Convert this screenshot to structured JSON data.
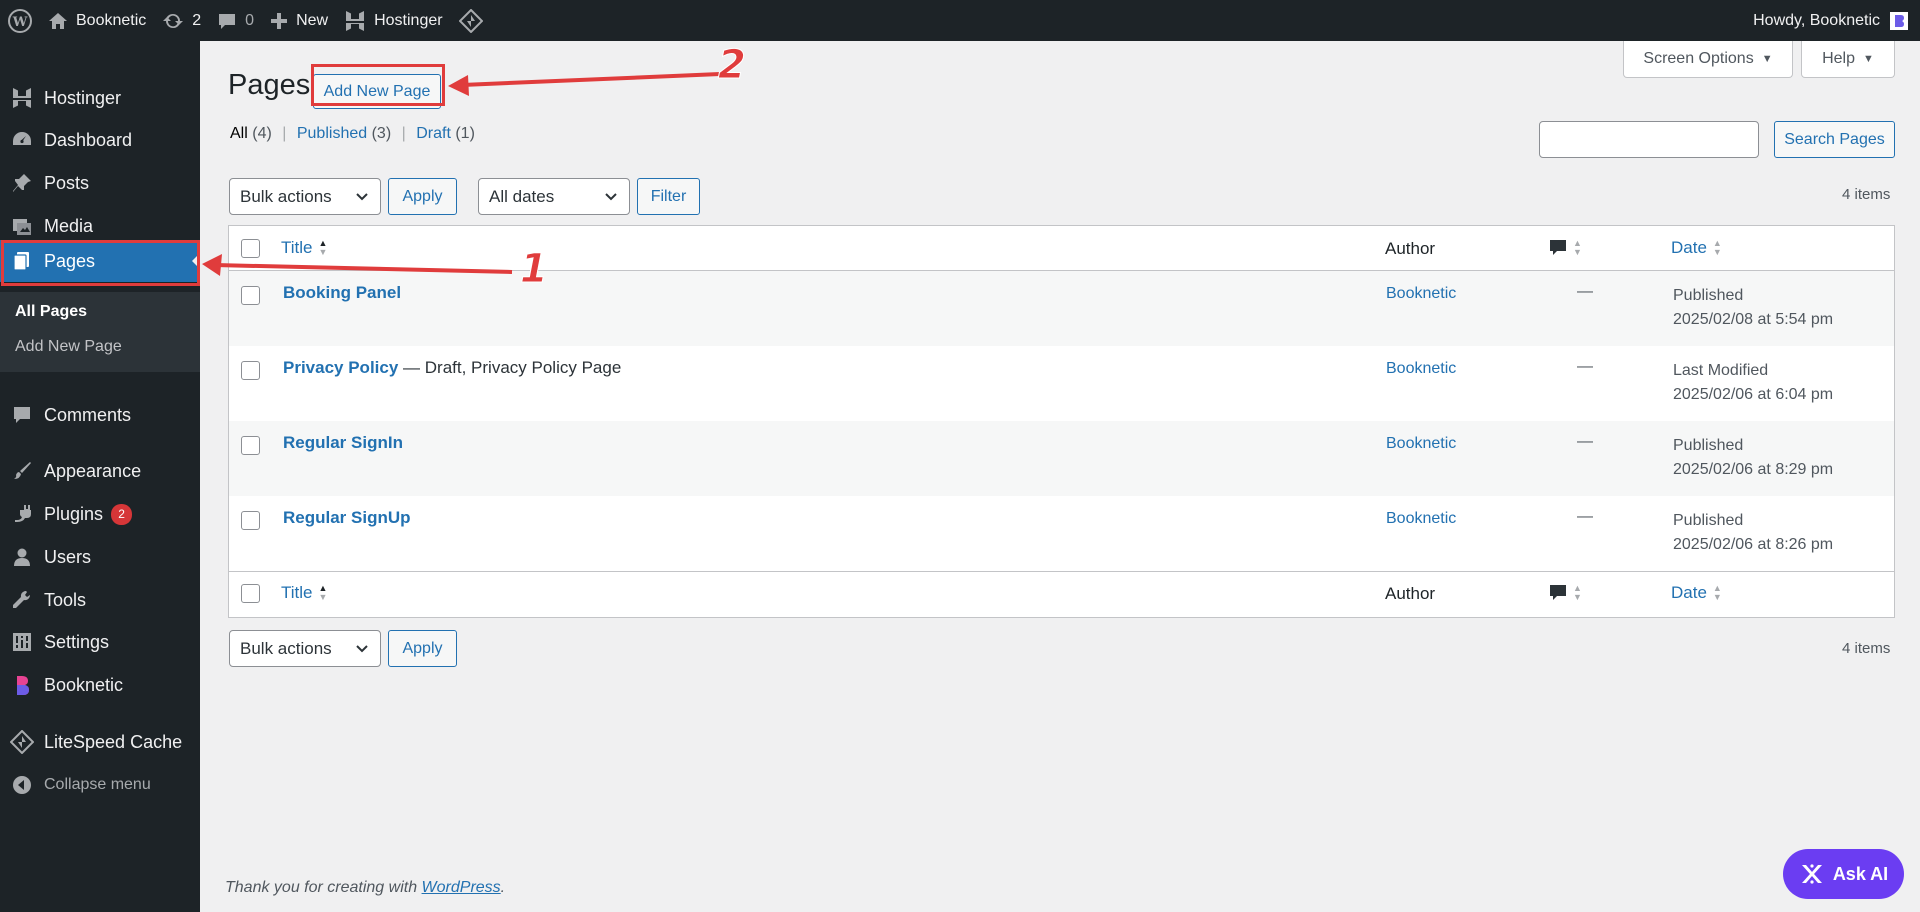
{
  "adminbar": {
    "site_name": "Booknetic",
    "updates_count": "2",
    "comments_count": "0",
    "new_label": "New",
    "hostinger_label": "Hostinger",
    "howdy": "Howdy, Booknetic"
  },
  "sidebar": {
    "items": [
      {
        "label": "Hostinger",
        "icon": "hostinger-icon"
      },
      {
        "label": "Dashboard",
        "icon": "dashboard-icon"
      },
      {
        "label": "Posts",
        "icon": "pin-icon"
      },
      {
        "label": "Media",
        "icon": "media-icon"
      },
      {
        "label": "Pages",
        "icon": "pages-icon"
      },
      {
        "label": "Comments",
        "icon": "comment-icon"
      },
      {
        "label": "Appearance",
        "icon": "brush-icon"
      },
      {
        "label": "Plugins",
        "icon": "plugin-icon",
        "badge": "2"
      },
      {
        "label": "Users",
        "icon": "user-icon"
      },
      {
        "label": "Tools",
        "icon": "wrench-icon"
      },
      {
        "label": "Settings",
        "icon": "settings-icon"
      },
      {
        "label": "Booknetic",
        "icon": "booknetic-icon"
      },
      {
        "label": "LiteSpeed Cache",
        "icon": "litespeed-icon"
      }
    ],
    "submenu": {
      "all_pages": "All Pages",
      "add_new": "Add New Page"
    },
    "collapse": "Collapse menu"
  },
  "header": {
    "screen_options": "Screen Options",
    "help": "Help",
    "title": "Pages",
    "add_new": "Add New Page"
  },
  "filters": {
    "all": "All",
    "all_count": "(4)",
    "published": "Published",
    "published_count": "(3)",
    "draft": "Draft",
    "draft_count": "(1)"
  },
  "search": {
    "button": "Search Pages"
  },
  "toolbar": {
    "bulk_actions": "Bulk actions",
    "apply": "Apply",
    "all_dates": "All dates",
    "filter": "Filter",
    "items": "4 items"
  },
  "table": {
    "columns": {
      "title": "Title",
      "author": "Author",
      "date": "Date"
    },
    "rows": [
      {
        "title": "Booking Panel",
        "state": "",
        "author": "Booknetic",
        "comments": "—",
        "status": "Published",
        "date": "2025/02/08 at 5:54 pm"
      },
      {
        "title": "Privacy Policy",
        "state": " — Draft, Privacy Policy Page",
        "author": "Booknetic",
        "comments": "—",
        "status": "Last Modified",
        "date": "2025/02/06 at 6:04 pm"
      },
      {
        "title": "Regular SignIn",
        "state": "",
        "author": "Booknetic",
        "comments": "—",
        "status": "Published",
        "date": "2025/02/06 at 8:29 pm"
      },
      {
        "title": "Regular SignUp",
        "state": "",
        "author": "Booknetic",
        "comments": "—",
        "status": "Published",
        "date": "2025/02/06 at 8:26 pm"
      }
    ]
  },
  "footer": {
    "text": "Thank you for creating with ",
    "link": "WordPress",
    "end": "."
  },
  "ask_ai": "Ask AI",
  "annotations": {
    "one": "1",
    "two": "2"
  },
  "colors": {
    "accent": "#2271b1",
    "annotation": "#e03c3c",
    "ask_ai": "#6b3df2"
  }
}
